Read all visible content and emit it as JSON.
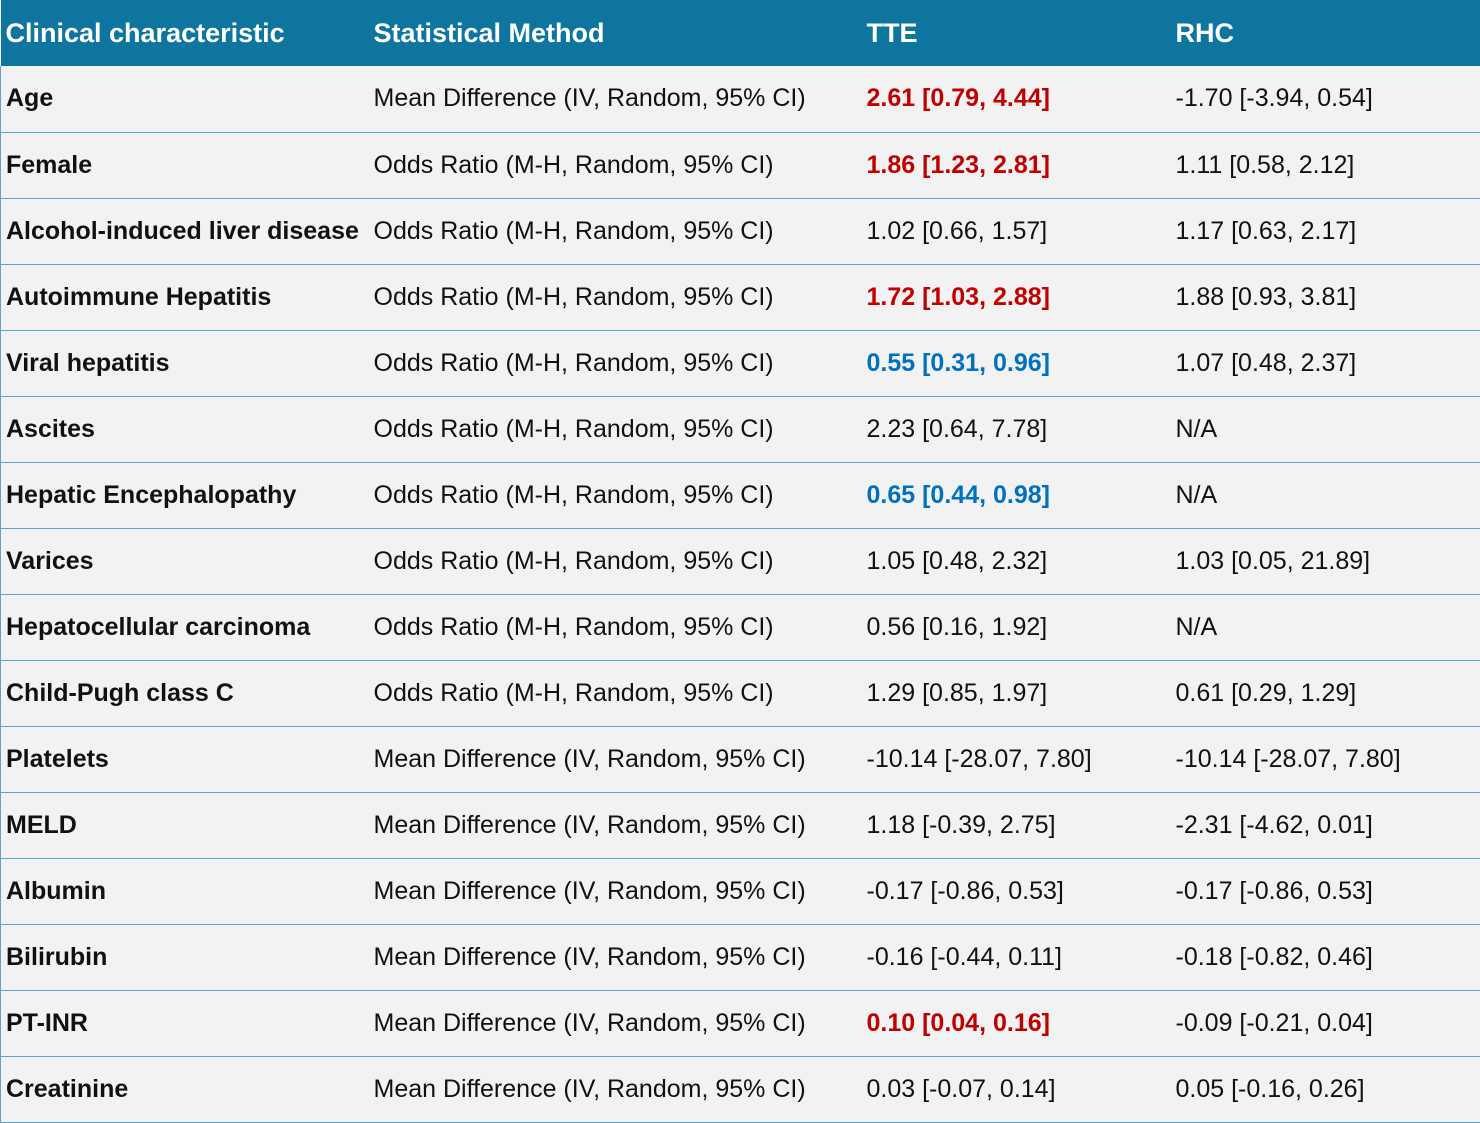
{
  "colors": {
    "header_bg": "#0e759f",
    "row_bg": "#f2f2f2",
    "significant_increase": "#c00000",
    "significant_decrease": "#0070c0"
  },
  "headers": [
    "Clinical characteristic",
    "Statistical Method",
    "TTE",
    "RHC"
  ],
  "rows": [
    {
      "characteristic": "Age",
      "method": "Mean Difference (IV, Random, 95% CI)",
      "tte": "2.61 [0.79, 4.44]",
      "tte_sig": "red",
      "rhc": "-1.70 [-3.94, 0.54]"
    },
    {
      "characteristic": "Female",
      "method": "Odds Ratio (M-H, Random, 95% CI)",
      "tte": "1.86 [1.23, 2.81]",
      "tte_sig": "red",
      "rhc": "1.11 [0.58, 2.12]"
    },
    {
      "characteristic": "Alcohol-induced liver disease",
      "method": "Odds Ratio (M-H, Random, 95% CI)",
      "tte": "1.02 [0.66, 1.57]",
      "tte_sig": "none",
      "rhc": "1.17 [0.63, 2.17]"
    },
    {
      "characteristic": "Autoimmune Hepatitis",
      "method": "Odds Ratio (M-H, Random, 95% CI)",
      "tte": "1.72 [1.03, 2.88]",
      "tte_sig": "red",
      "rhc": "1.88 [0.93, 3.81]"
    },
    {
      "characteristic": "Viral hepatitis",
      "method": "Odds Ratio (M-H, Random, 95% CI)",
      "tte": "0.55 [0.31, 0.96]",
      "tte_sig": "blue",
      "rhc": "1.07 [0.48, 2.37]"
    },
    {
      "characteristic": "Ascites",
      "method": "Odds Ratio (M-H, Random, 95% CI)",
      "tte": "2.23 [0.64, 7.78]",
      "tte_sig": "none",
      "rhc": "N/A"
    },
    {
      "characteristic": "Hepatic Encephalopathy",
      "method": "Odds Ratio (M-H, Random, 95% CI)",
      "tte": "0.65 [0.44, 0.98]",
      "tte_sig": "blue",
      "rhc": "N/A"
    },
    {
      "characteristic": "Varices",
      "method": "Odds Ratio (M-H, Random, 95% CI)",
      "tte": "1.05 [0.48, 2.32]",
      "tte_sig": "none",
      "rhc": "1.03 [0.05, 21.89]"
    },
    {
      "characteristic": "Hepatocellular carcinoma",
      "method": "Odds Ratio (M-H, Random, 95% CI)",
      "tte": "0.56 [0.16, 1.92]",
      "tte_sig": "none",
      "rhc": "N/A"
    },
    {
      "characteristic": "Child-Pugh class C",
      "method": "Odds Ratio (M-H, Random, 95% CI)",
      "tte": "1.29 [0.85, 1.97]",
      "tte_sig": "none",
      "rhc": "0.61 [0.29, 1.29]"
    },
    {
      "characteristic": "Platelets",
      "method": "Mean Difference (IV, Random, 95% CI)",
      "tte": "-10.14 [-28.07, 7.80]",
      "tte_sig": "none",
      "rhc": "-10.14 [-28.07, 7.80]"
    },
    {
      "characteristic": "MELD",
      "method": "Mean Difference (IV, Random, 95% CI)",
      "tte": "1.18 [-0.39, 2.75]",
      "tte_sig": "none",
      "rhc": "-2.31 [-4.62, 0.01]"
    },
    {
      "characteristic": "Albumin",
      "method": "Mean Difference (IV, Random, 95% CI)",
      "tte": "-0.17 [-0.86, 0.53]",
      "tte_sig": "none",
      "rhc": "-0.17 [-0.86, 0.53]"
    },
    {
      "characteristic": "Bilirubin",
      "method": "Mean Difference (IV, Random, 95% CI)",
      "tte": "-0.16 [-0.44, 0.11]",
      "tte_sig": "none",
      "rhc": "-0.18 [-0.82, 0.46]"
    },
    {
      "characteristic": "PT-INR",
      "method": "Mean Difference (IV, Random, 95% CI)",
      "tte": "0.10 [0.04, 0.16]",
      "tte_sig": "red",
      "rhc": "-0.09 [-0.21, 0.04]"
    },
    {
      "characteristic": "Creatinine",
      "method": "Mean Difference (IV, Random, 95% CI)",
      "tte": "0.03 [-0.07, 0.14]",
      "tte_sig": "none",
      "rhc": "0.05 [-0.16, 0.26]"
    }
  ]
}
